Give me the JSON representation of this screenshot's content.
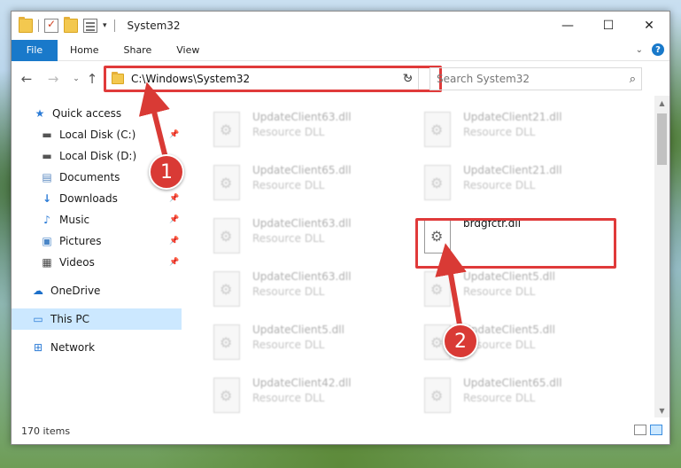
{
  "window": {
    "title": "System32",
    "controls": {
      "minimize": "—",
      "maximize": "☐",
      "close": "✕"
    }
  },
  "ribbon": {
    "tabs": [
      "File",
      "Home",
      "Share",
      "View"
    ],
    "help": "?"
  },
  "address": {
    "path": "C:\\Windows\\System32",
    "search_placeholder": "Search System32"
  },
  "sidebar": {
    "items": [
      {
        "label": "Quick access",
        "icon": "star-icon"
      },
      {
        "label": "Local Disk (C:)",
        "icon": "drive-icon"
      },
      {
        "label": "Local Disk (D:)",
        "icon": "drive-icon"
      },
      {
        "label": "Documents",
        "icon": "documents-icon"
      },
      {
        "label": "Downloads",
        "icon": "download-icon"
      },
      {
        "label": "Music",
        "icon": "music-icon"
      },
      {
        "label": "Pictures",
        "icon": "pictures-icon"
      },
      {
        "label": "Videos",
        "icon": "videos-icon"
      },
      {
        "label": "OneDrive",
        "icon": "cloud-icon"
      },
      {
        "label": "This PC",
        "icon": "computer-icon"
      },
      {
        "label": "Network",
        "icon": "network-icon"
      }
    ],
    "selected": "This PC"
  },
  "files": [
    {
      "name": "UpdateClient63.dll",
      "type": "Resource DLL"
    },
    {
      "name": "UpdateClient21.dll",
      "type": "Resource DLL"
    },
    {
      "name": "UpdateClient65.dll",
      "type": "Resource DLL"
    },
    {
      "name": "UpdateClient21.dll",
      "type": "Resource DLL"
    },
    {
      "name": "UpdateClient63.dll",
      "type": "Resource DLL"
    },
    {
      "name": "brdgfctr.dll",
      "type": ""
    },
    {
      "name": "UpdateClient63.dll",
      "type": "Resource DLL"
    },
    {
      "name": "UpdateClient5.dll",
      "type": "Resource DLL"
    },
    {
      "name": "UpdateClient5.dll",
      "type": "Resource DLL"
    },
    {
      "name": "UpdateClient5.dll",
      "type": "Resource DLL"
    },
    {
      "name": "UpdateClient42.dll",
      "type": "Resource DLL"
    },
    {
      "name": "UpdateClient65.dll",
      "type": "Resource DLL"
    }
  ],
  "status": {
    "item_count": "170 items"
  },
  "annotations": {
    "badge1": "1",
    "badge2": "2",
    "color": "#d93a35"
  }
}
